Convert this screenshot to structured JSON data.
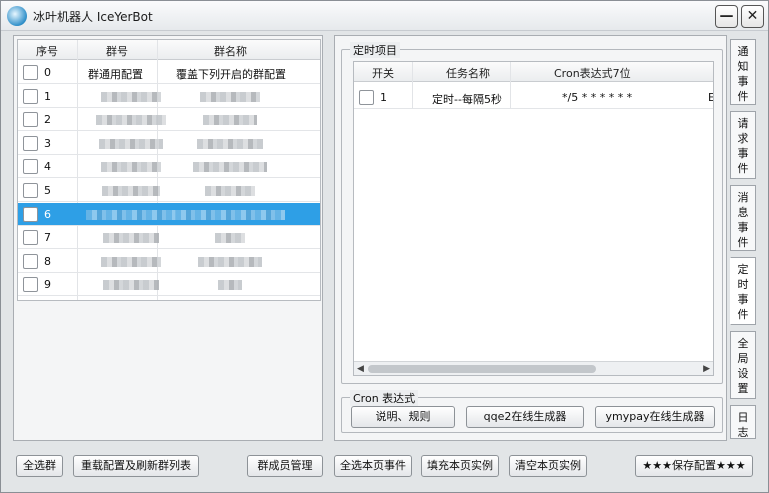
{
  "window": {
    "title": "冰叶机器人 IceYerBot",
    "min_label": "—",
    "close_label": "✕"
  },
  "groups": {
    "headers": [
      "序号",
      "群号",
      "群名称"
    ],
    "rows": [
      {
        "index": "0",
        "group_id": "群通用配置",
        "group_name": "覆盖下列开启的群配置",
        "checked": false,
        "selected": false
      },
      {
        "index": "1",
        "group_id": "",
        "group_name": "",
        "checked": false,
        "selected": false
      },
      {
        "index": "2",
        "group_id": "",
        "group_name": "",
        "checked": false,
        "selected": false
      },
      {
        "index": "3",
        "group_id": "",
        "group_name": "",
        "checked": false,
        "selected": false
      },
      {
        "index": "4",
        "group_id": "",
        "group_name": "",
        "checked": false,
        "selected": false
      },
      {
        "index": "5",
        "group_id": "",
        "group_name": "",
        "checked": false,
        "selected": false
      },
      {
        "index": "6",
        "group_id": "",
        "group_name": "",
        "checked": false,
        "selected": true
      },
      {
        "index": "7",
        "group_id": "",
        "group_name": "",
        "checked": false,
        "selected": false
      },
      {
        "index": "8",
        "group_id": "",
        "group_name": "",
        "checked": false,
        "selected": false
      },
      {
        "index": "9",
        "group_id": "",
        "group_name": "",
        "checked": false,
        "selected": false
      }
    ]
  },
  "scheduled": {
    "title": "定时项目",
    "headers": [
      "开关",
      "任务名称",
      "Cron表达式7位"
    ],
    "rows": [
      {
        "index": "1",
        "name": "定时--每隔5秒",
        "cron": "*/5 * * * * * *",
        "trailing": "E",
        "checked": false
      }
    ]
  },
  "cron": {
    "title": "Cron 表达式",
    "buttons": [
      "说明、规则",
      "qqe2在线生成器",
      "ymypay在线生成器"
    ]
  },
  "side_tabs": [
    {
      "label": "通\n知\n事\n件",
      "active": false
    },
    {
      "label": "请\n求\n事\n件",
      "active": false
    },
    {
      "label": "消\n息\n事\n件",
      "active": false
    },
    {
      "label": "定\n时\n事\n件",
      "active": true
    },
    {
      "label": "全\n局\n设\n置",
      "active": false
    },
    {
      "label": "日\n志",
      "active": false
    }
  ],
  "bottom_buttons": [
    "全选群",
    "重载配置及刷新群列表",
    "群成员管理",
    "全选本页事件",
    "填充本页实例",
    "清空本页实例",
    "★★★保存配置★★★"
  ]
}
